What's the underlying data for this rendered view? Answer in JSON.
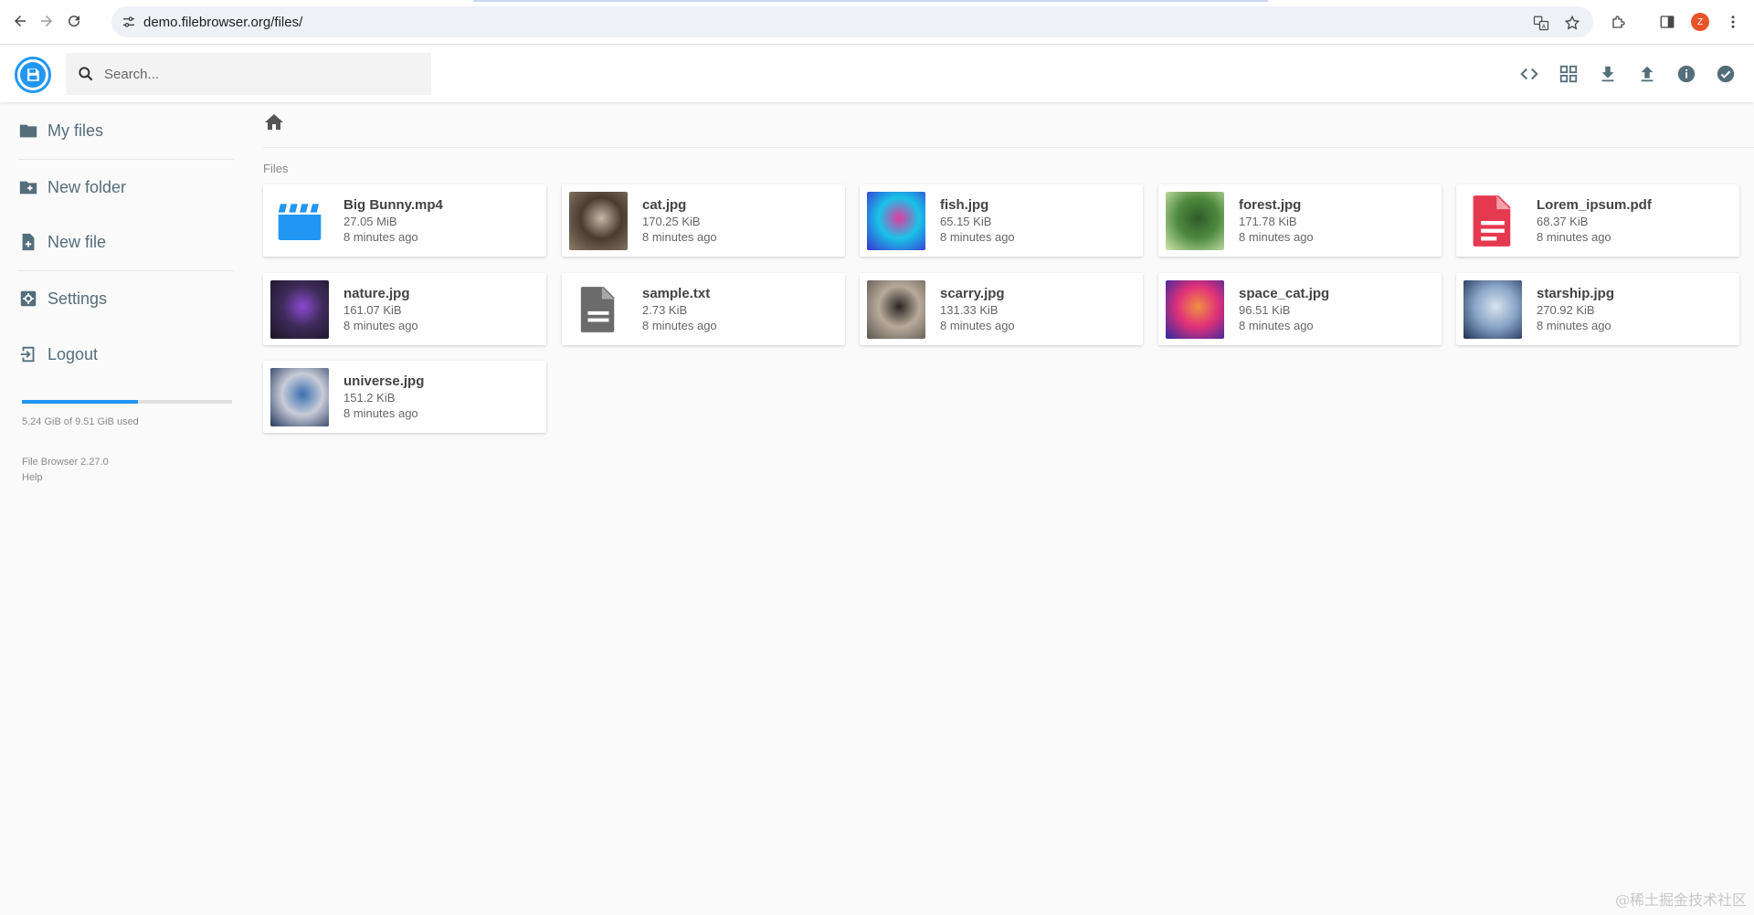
{
  "browser": {
    "url": "demo.filebrowser.org/files/",
    "profile_initial": "Z"
  },
  "header": {
    "search_placeholder": "Search...",
    "actions": [
      {
        "name": "toggle-code-button",
        "icon": "code-icon"
      },
      {
        "name": "switch-view-button",
        "icon": "grid-view-icon"
      },
      {
        "name": "download-button",
        "icon": "download-icon"
      },
      {
        "name": "upload-button",
        "icon": "upload-icon"
      },
      {
        "name": "info-button",
        "icon": "info-icon"
      },
      {
        "name": "select-multiple-button",
        "icon": "check-circle-icon"
      }
    ]
  },
  "sidebar": {
    "items": [
      {
        "label": "My files",
        "icon": "folder-icon"
      },
      {
        "label": "New folder",
        "icon": "create-new-folder-icon"
      },
      {
        "label": "New file",
        "icon": "note-add-icon"
      },
      {
        "label": "Settings",
        "icon": "settings-icon"
      },
      {
        "label": "Logout",
        "icon": "logout-icon"
      }
    ],
    "usage": {
      "text": "5.24 GiB of 9.51 GiB used",
      "fraction": 0.551
    },
    "credits": {
      "version": "File Browser 2.27.0",
      "help": "Help"
    }
  },
  "main": {
    "section_title": "Files",
    "files": [
      {
        "name": "Big Bunny.mp4",
        "size": "27.05 MiB",
        "modified": "8 minutes ago",
        "kind": "video"
      },
      {
        "name": "cat.jpg",
        "size": "170.25 KiB",
        "modified": "8 minutes ago",
        "kind": "image",
        "colors": [
          "#8b7b6b",
          "#4a3b2f",
          "#c4b8a8"
        ]
      },
      {
        "name": "fish.jpg",
        "size": "65.15 KiB",
        "modified": "8 minutes ago",
        "kind": "image",
        "colors": [
          "#3a2fd0",
          "#19c3e8",
          "#e03aa0"
        ]
      },
      {
        "name": "forest.jpg",
        "size": "171.78 KiB",
        "modified": "8 minutes ago",
        "kind": "image",
        "colors": [
          "#cfe6b0",
          "#4e8a3e",
          "#2f5a2a"
        ]
      },
      {
        "name": "Lorem_ipsum.pdf",
        "size": "68.37 KiB",
        "modified": "8 minutes ago",
        "kind": "pdf"
      },
      {
        "name": "nature.jpg",
        "size": "161.07 KiB",
        "modified": "8 minutes ago",
        "kind": "image",
        "colors": [
          "#1b1525",
          "#3e2b5a",
          "#8a4ad0"
        ]
      },
      {
        "name": "sample.txt",
        "size": "2.73 KiB",
        "modified": "8 minutes ago",
        "kind": "text"
      },
      {
        "name": "scarry.jpg",
        "size": "131.33 KiB",
        "modified": "8 minutes ago",
        "kind": "image",
        "colors": [
          "#5a5550",
          "#b8aa9a",
          "#2a2522"
        ]
      },
      {
        "name": "space_cat.jpg",
        "size": "96.51 KiB",
        "modified": "8 minutes ago",
        "kind": "image",
        "colors": [
          "#2a2aa0",
          "#e0307a",
          "#f09040"
        ]
      },
      {
        "name": "starship.jpg",
        "size": "270.92 KiB",
        "modified": "8 minutes ago",
        "kind": "image",
        "colors": [
          "#1d2f55",
          "#8aa6c8",
          "#d9e3ee"
        ]
      },
      {
        "name": "universe.jpg",
        "size": "151.2 KiB",
        "modified": "8 minutes ago",
        "kind": "image",
        "colors": [
          "#24365e",
          "#c8ccd8",
          "#3b6fb0"
        ]
      }
    ]
  },
  "watermark": "@稀土掘金技术社区",
  "colors": {
    "accent": "#2196f3",
    "pdf": "#e53950",
    "text_icon": "#6b6b6b",
    "video": "#2196f3"
  }
}
